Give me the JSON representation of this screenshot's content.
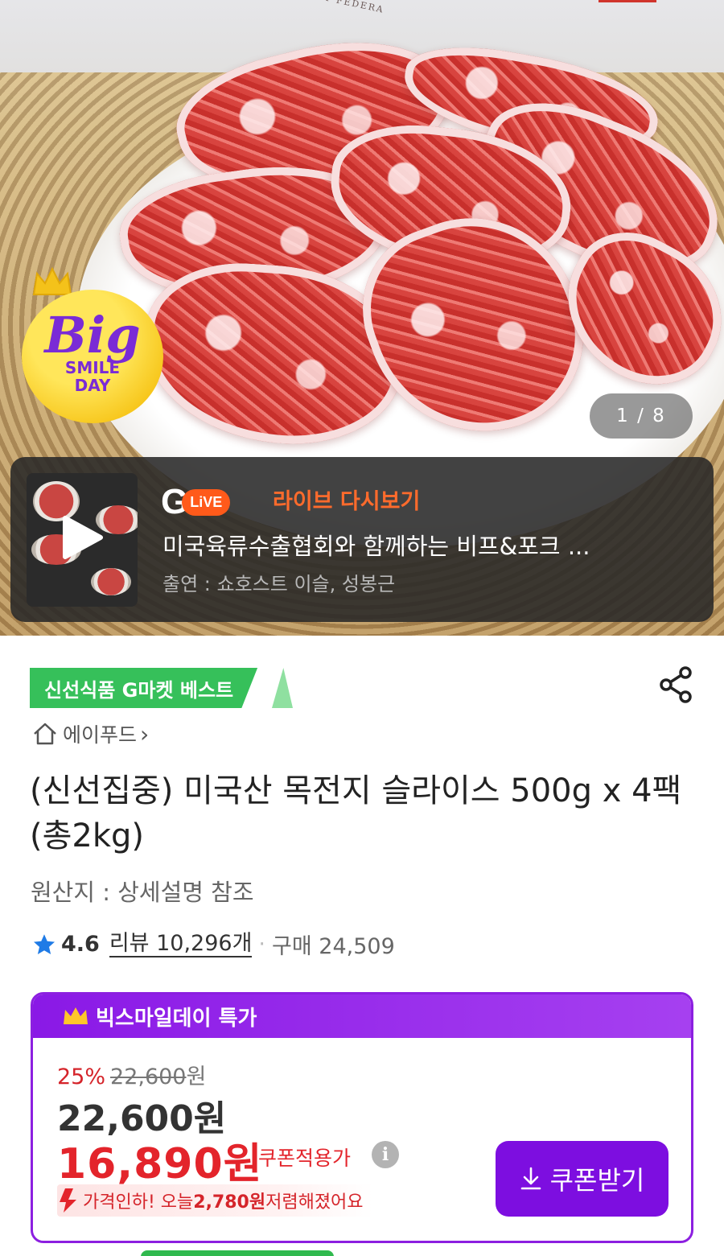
{
  "hero": {
    "stamp_text": "ORT FEDERA",
    "badge": {
      "big": "Big",
      "smile": "SMILE",
      "day": "DAY"
    },
    "counter": "1 / 8"
  },
  "live_banner": {
    "logo_g": "G",
    "logo_live": "LiVE",
    "replay_label": "라이브 다시보기",
    "title": "미국육류수출협회와 함께하는 비프&포크 ...",
    "cast": "출연 : 쇼호스트 이슬, 성봉근"
  },
  "product": {
    "best_badge": "신선식품 G마켓 베스트",
    "seller": "에이푸드",
    "seller_arrow": "›",
    "title": "(신선집중) 미국산 목전지 슬라이스 500g x 4팩 (총2kg)",
    "origin": "원산지 : 상세설명 참조",
    "rating": {
      "score": "4.6",
      "reviews": "리뷰 10,296개",
      "separator": "·",
      "sold": "구매 24,509"
    }
  },
  "deal": {
    "header": "빅스마일데이 특가",
    "discount_pct": "25%",
    "original_price": "22,600",
    "original_currency": "원",
    "price": "22,600원",
    "coupon_price": "16,890원",
    "coupon_label": "쿠폰적용가",
    "info": "i",
    "drop_prefix": "가격인하! 오늘 ",
    "drop_amount": "2,780원",
    "drop_suffix": " 저렴해졌어요",
    "coupon_button": "쿠폰받기"
  },
  "colors": {
    "accent_purple": "#7d0ee0",
    "sale_red": "#e3242b",
    "live_orange": "#ff6b2c",
    "best_green": "#36c05a"
  },
  "icons": {
    "home": "home-icon",
    "share": "share-icon",
    "star": "star-icon",
    "crown": "crown-icon",
    "download": "download-icon",
    "play": "play-icon"
  }
}
